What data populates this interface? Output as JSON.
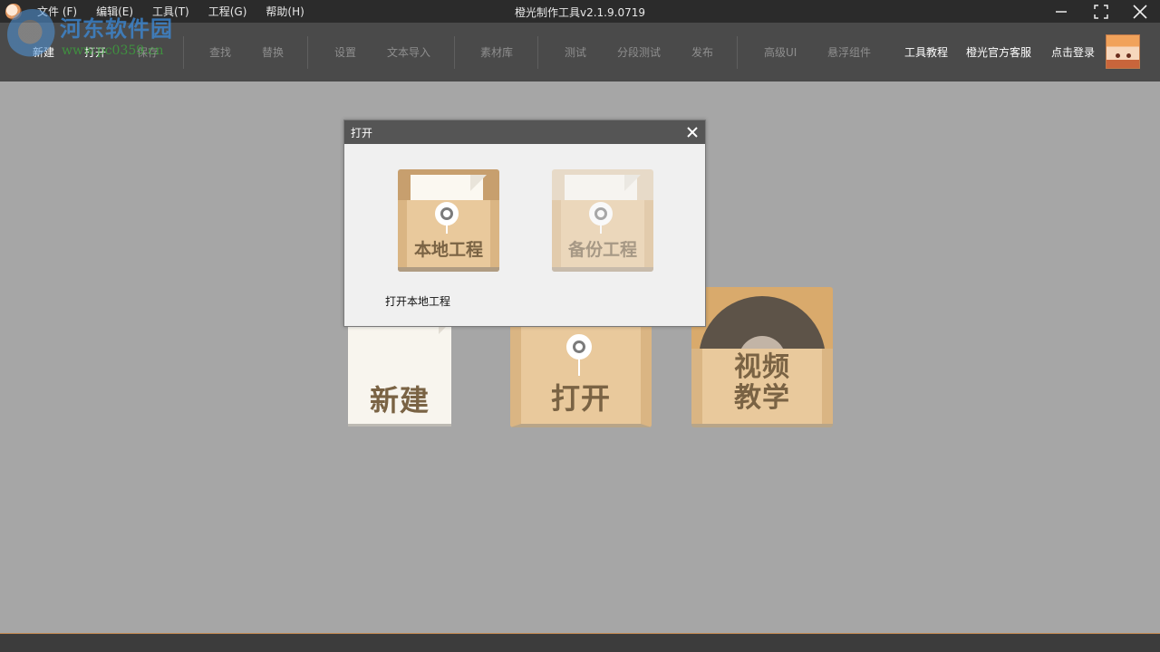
{
  "titlebar": {
    "title": "橙光制作工具v2.1.9.0719",
    "menu": [
      "文件 (F)",
      "编辑(E)",
      "工具(T)",
      "工程(G)",
      "帮助(H)"
    ]
  },
  "toolbar": {
    "new": "新建",
    "open": "打开",
    "save": "保存",
    "find": "查找",
    "replace": "替换",
    "settings": "设置",
    "text_import": "文本导入",
    "asset_library": "素材库",
    "test": "测试",
    "segment_test": "分段测试",
    "publish": "发布",
    "advanced_ui": "高级UI",
    "floating_component": "悬浮组件",
    "tutorial": "工具教程",
    "official_support": "橙光官方客服",
    "login": "点击登录"
  },
  "watermark": {
    "text": "河东软件园",
    "url": "www.pc0359.cn"
  },
  "main": {
    "new_tile": "新建",
    "open_tile": "打开",
    "video_tile": [
      "视频",
      "教学"
    ]
  },
  "dialog": {
    "title": "打开",
    "local_project": "本地工程",
    "backup_project": "备份工程",
    "hint": "打开本地工程"
  },
  "colors": {
    "titlebar_bg": "#2b2b2b",
    "toolbar_bg": "#4a4a4a",
    "workspace_bg": "#a6a6a6",
    "folder_tan": "#e9c99c",
    "label_brown": "#7a6344"
  }
}
